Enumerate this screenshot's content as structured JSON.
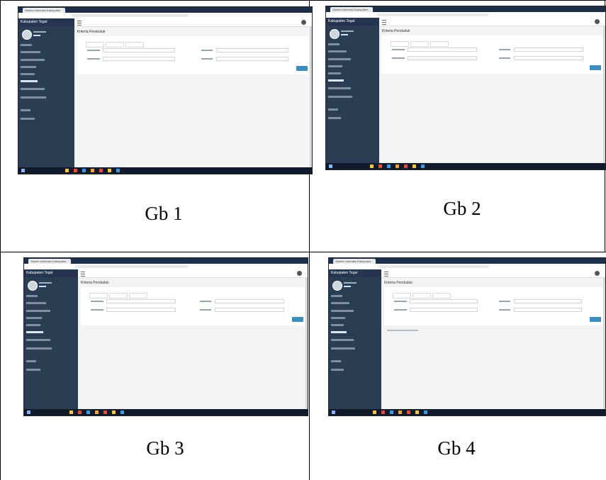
{
  "cells": [
    {
      "caption": "Gb 1",
      "screenshot": {
        "tab_title": "Sistem Informasi Kabupaten",
        "brand": "Kabupaten Tegal",
        "heading": "Kriteria Penduduk",
        "has_note": false
      }
    },
    {
      "caption": "Gb 2",
      "screenshot": {
        "tab_title": "Sistem Informasi Kabupaten",
        "brand": "Kabupaten Tegal",
        "heading": "Kriteria Penduduk",
        "has_note": false
      }
    },
    {
      "caption": "Gb 3",
      "screenshot": {
        "tab_title": "Sistem Informasi Kabupaten",
        "brand": "Kabupaten Tegal",
        "heading": "Kriteria Penduduk",
        "has_note": false
      }
    },
    {
      "caption": "Gb 4",
      "screenshot": {
        "tab_title": "Sistem Informasi Kabupaten",
        "brand": "Kabupaten Tegal",
        "heading": "Kriteria Penduduk",
        "has_note": true
      }
    }
  ],
  "colors": {
    "sidebar": "#2b3c55",
    "accent": "#3c8dbc",
    "taskbar": "#111a2b"
  }
}
